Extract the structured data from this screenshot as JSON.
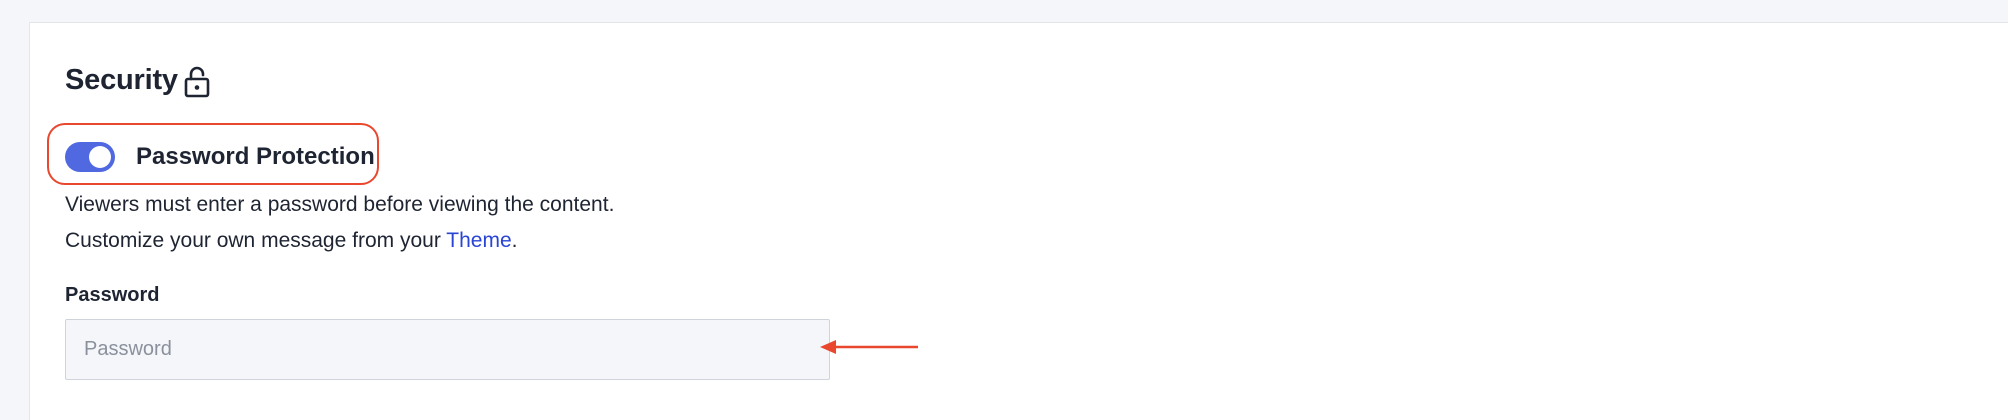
{
  "security": {
    "title": "Security",
    "lock_icon": "lock-open-icon"
  },
  "password_protection": {
    "label": "Password Protection",
    "enabled": true,
    "toggle_color": "#5068e0",
    "description": "Viewers must enter a password before viewing the content.",
    "customize_prefix": "Customize your own message from your ",
    "customize_link": "Theme",
    "customize_suffix": "."
  },
  "password_field": {
    "label": "Password",
    "placeholder": "Password",
    "value": ""
  },
  "annotations": {
    "highlight_color": "#e9482f",
    "arrow_icon": "arrow-left-icon"
  }
}
